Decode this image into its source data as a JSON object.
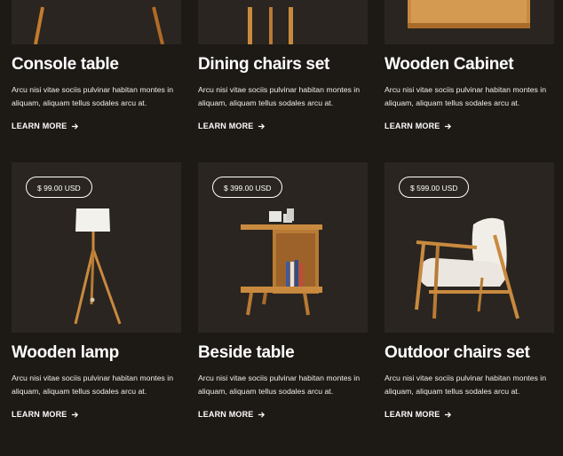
{
  "products": [
    {
      "id": "console",
      "title": "Console table",
      "description": "Arcu nisi vitae sociis pulvinar habitan montes in aliquam, aliquam tellus sodales arcu at.",
      "cta": "LEARN MORE"
    },
    {
      "id": "dining",
      "title": "Dining chairs set",
      "description": "Arcu nisi vitae sociis pulvinar habitan montes in aliquam, aliquam tellus sodales arcu at.",
      "cta": "LEARN MORE"
    },
    {
      "id": "cabinet",
      "title": "Wooden Cabinet",
      "description": "Arcu nisi vitae sociis pulvinar habitan montes in aliquam, aliquam tellus sodales arcu at.",
      "cta": "LEARN MORE"
    },
    {
      "id": "lamp",
      "title": "Wooden lamp",
      "price": "$ 99.00 USD",
      "description": "Arcu nisi vitae sociis pulvinar habitan montes in aliquam, aliquam tellus sodales arcu at.",
      "cta": "LEARN MORE"
    },
    {
      "id": "beside",
      "title": "Beside table",
      "price": "$ 399.00 USD",
      "description": "Arcu nisi vitae sociis pulvinar habitan montes in aliquam, aliquam tellus sodales arcu at.",
      "cta": "LEARN MORE"
    },
    {
      "id": "outdoor",
      "title": "Outdoor chairs set",
      "price": "$ 599.00 USD",
      "description": "Arcu nisi vitae sociis pulvinar habitan montes in aliquam, aliquam tellus sodales arcu at.",
      "cta": "LEARN MORE"
    }
  ],
  "icons": {
    "cta": "arrow-right-icon"
  },
  "colors": {
    "background": "#1d1915",
    "card": "#2a2520",
    "wood": "#c98a3f",
    "text": "#ffffff"
  }
}
